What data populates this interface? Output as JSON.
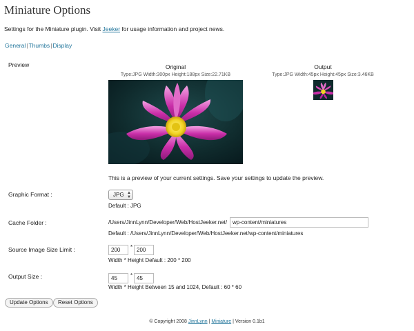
{
  "page": {
    "title": "Miniature Options",
    "intro_before": "Settings for the Miniature plugin. Visit ",
    "intro_link": "Jeeker",
    "intro_after": " for usage information and project news."
  },
  "subnav": {
    "items": [
      "General",
      "Thumbs",
      "Display"
    ],
    "separator": "|"
  },
  "preview": {
    "label": "Preview",
    "original": {
      "heading": "Original",
      "meta": "Type:JPG  Width:300px  Height:188px  Size:22.71KB"
    },
    "output": {
      "heading": "Output",
      "meta": "Type:JPG  Width:45px  Height:45px  Size:3.46KB"
    },
    "note": "This is a preview of your current settings. Save your settings to update the preview."
  },
  "graphic_format": {
    "label": "Graphic Format :",
    "selected": "JPG",
    "default_text": "Default : JPG"
  },
  "cache_folder": {
    "label": "Cache Folder :",
    "prefix": "/Users/JinnLynn/Developer/Web/HostJeeker.net/",
    "value": "wp-content/miniatures",
    "default_text": "Default : /Users/JinnLynn/Developer/Web/HostJeeker.net/wp-content/miniatures"
  },
  "source_limit": {
    "label": "Source Image Size Limit :",
    "width": "200",
    "height": "200",
    "separator": "*",
    "default_text": "Width * Height Default : 200 * 200"
  },
  "output_size": {
    "label": "Output Size :",
    "width": "45",
    "height": "45",
    "separator": "*",
    "default_text": "Width * Height Between 15 and 1024, Default : 60 * 60"
  },
  "buttons": {
    "update": "Update Options",
    "reset": "Reset Options"
  },
  "footer": {
    "copyright": "© Copyright 2008 ",
    "author_link": "JinnLynn",
    "sep": " | ",
    "plugin_link": "Miniature",
    "version": " | Version 0.1b1"
  },
  "colors": {
    "link": "#21759b",
    "flower_petal": "#c92ea8",
    "flower_center": "#f1d322",
    "background_dark": "#0f2a2c"
  },
  "icons": {
    "select_arrows": "updown-arrows-icon"
  }
}
